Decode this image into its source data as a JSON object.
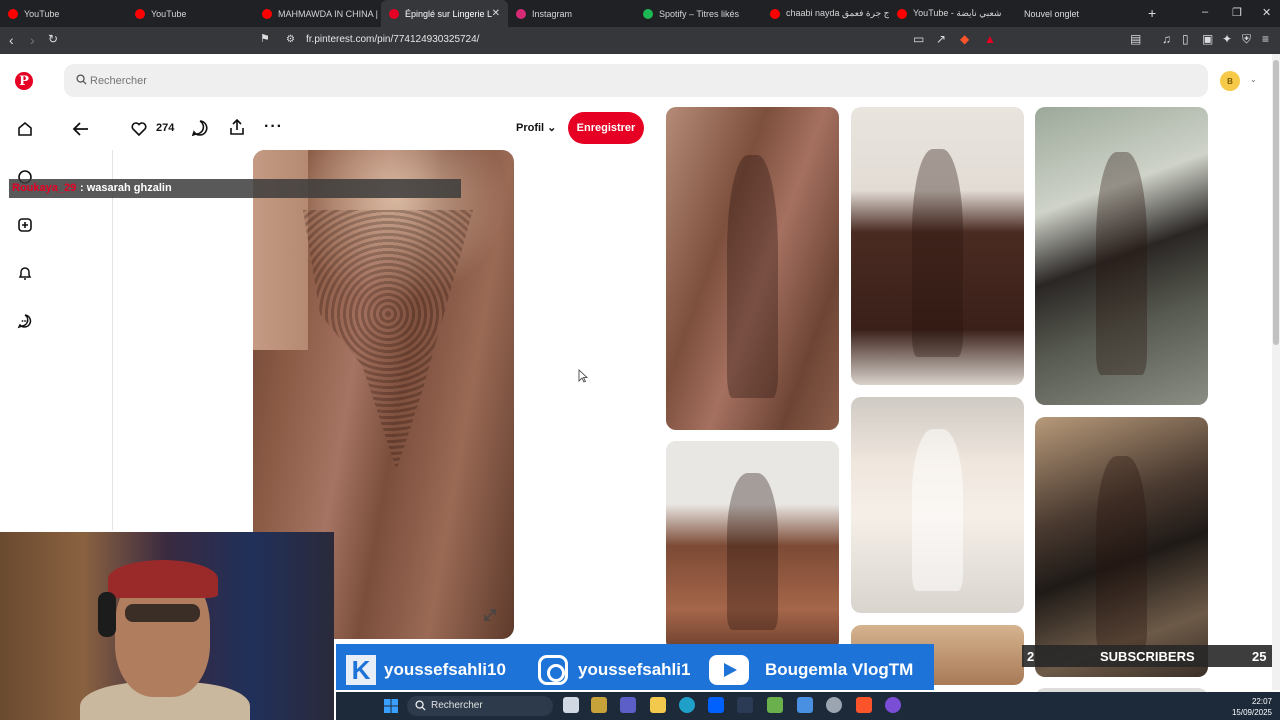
{
  "browser": {
    "tabs": [
      {
        "label": "YouTube",
        "favicon_color": "#ff0000",
        "active": false
      },
      {
        "label": "YouTube",
        "favicon_color": "#ff0000",
        "active": false
      },
      {
        "label": "MAHMAWDA IN CHINA |",
        "favicon_color": "#ff0000",
        "active": false
      },
      {
        "label": "Épinglé sur Lingerie L",
        "favicon_color": "#e60023",
        "active": true
      },
      {
        "label": "Instagram",
        "favicon_color": "#d62976",
        "active": false
      },
      {
        "label": "Spotify – Titres likés",
        "favicon_color": "#1db954",
        "active": false
      },
      {
        "label": "chaabi nayda ج جرة فعمق",
        "favicon_color": "#ff0000",
        "active": false
      },
      {
        "label": "YouTube - شعبي نايضة",
        "favicon_color": "#ff0000",
        "active": false
      },
      {
        "label": "Nouvel onglet",
        "favicon_color": "#888888",
        "active": false
      }
    ],
    "url": "fr.pinterest.com/pin/774124930325724/",
    "new_tab_symbol": "+",
    "window_controls": [
      "–",
      "❐",
      "✕"
    ]
  },
  "pinterest": {
    "search_placeholder": "Rechercher",
    "avatar_initial": "B",
    "like_count": "274",
    "profile_label": "Profil",
    "save_label": "Enregistrer",
    "accent_color": "#e60023"
  },
  "overlay": {
    "chat_user": "Roukaya_29",
    "chat_message": ": wasarah ghzalin",
    "social": [
      {
        "platform": "kick",
        "handle": "youssefsahli10"
      },
      {
        "platform": "instagram",
        "handle": "youssefsahli1"
      },
      {
        "platform": "youtube",
        "handle": "Bougemla VlogTM"
      }
    ],
    "subs_left": "2",
    "subs_label": "SUBSCRIBERS",
    "subs_right": "25"
  },
  "taskbar": {
    "search_label": "Rechercher",
    "time": "22:07",
    "date": "15/09/2025"
  }
}
